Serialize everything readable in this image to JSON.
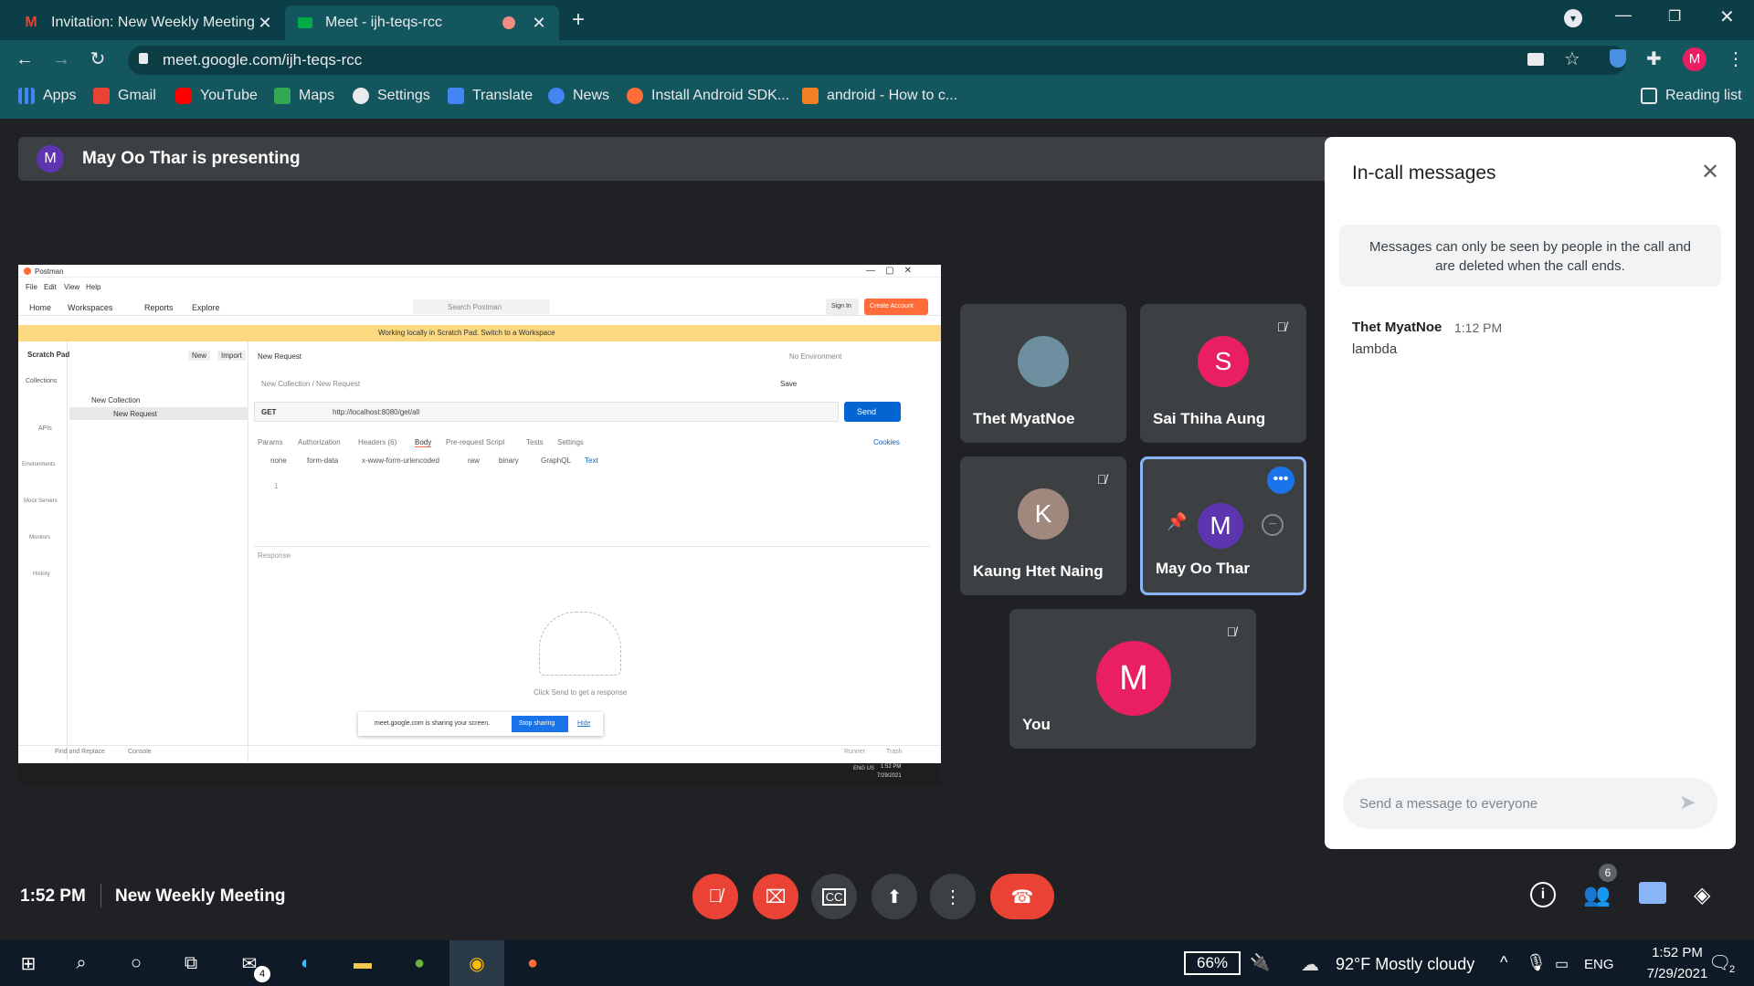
{
  "browser": {
    "tabs": [
      {
        "title": "Invitation: New Weekly Meeting",
        "icon": "gmail-icon"
      },
      {
        "title": "Meet - ijh-teqs-rcc",
        "icon": "meet-icon"
      }
    ],
    "url": "meet.google.com/ijh-teqs-rcc",
    "profile_initial": "M",
    "bookmarks": [
      "Apps",
      "Gmail",
      "YouTube",
      "Maps",
      "Settings",
      "Translate",
      "News",
      "Install Android SDK...",
      "android - How to c..."
    ],
    "reading_list": "Reading list"
  },
  "meet": {
    "presenter_initial": "M",
    "presenting_text": "May Oo Thar is presenting",
    "participants": [
      {
        "name": "Thet MyatNoe",
        "initial": "",
        "color": "#6d8fa0",
        "muted": false
      },
      {
        "name": "Sai Thiha Aung",
        "initial": "S",
        "color": "#e91e63",
        "muted": true
      },
      {
        "name": "Kaung Htet Naing",
        "initial": "K",
        "color": "#a1887f",
        "muted": true
      },
      {
        "name": "May Oo Thar",
        "initial": "M",
        "color": "#5e35b1",
        "muted": false
      },
      {
        "name": "You",
        "initial": "M",
        "color": "#e91e63",
        "muted": true
      }
    ],
    "panel": {
      "title": "In-call messages",
      "notice": "Messages can only be seen by people in the call and are deleted when the call ends.",
      "messages": [
        {
          "sender": "Thet MyatNoe",
          "time": "1:12 PM",
          "text": "lambda"
        }
      ],
      "input_placeholder": "Send a message to everyone"
    },
    "bottom": {
      "time": "1:52 PM",
      "meeting_name": "New Weekly Meeting",
      "people_count": "6"
    }
  },
  "postman": {
    "title": "Postman",
    "menu": [
      "File",
      "Edit",
      "View",
      "Help"
    ],
    "nav": [
      "Home",
      "Workspaces",
      "Reports",
      "Explore"
    ],
    "search": "Search Postman",
    "sign_in": "Sign In",
    "create_account": "Create Account",
    "banner": "Working locally in Scratch Pad. Switch to a Workspace",
    "scratch_pad": "Scratch Pad",
    "new": "New",
    "import": "Import",
    "tab": "New Request",
    "env": "No Environment",
    "breadcrumb": "New Collection / New Request",
    "save": "Save",
    "collection": "New Collection",
    "request": "New Request",
    "method": "GET",
    "request_url": "http://localhost:8080/get/all",
    "send": "Send",
    "req_tabs": [
      "Params",
      "Authorization",
      "Headers (6)",
      "Body",
      "Pre-request Script",
      "Tests",
      "Settings"
    ],
    "cookies": "Cookies",
    "body_types": [
      "none",
      "form-data",
      "x-www-form-urlencoded",
      "raw",
      "binary",
      "GraphQL"
    ],
    "text_type": "Text",
    "line_no": "1",
    "response": "Response",
    "hint": "Click Send to get a response",
    "sharing_msg": "meet.google.com is sharing your screen.",
    "stop_sharing": "Stop sharing",
    "hide": "Hide",
    "sidebar": [
      "Collections",
      "APIs",
      "Environments",
      "Mock Servers",
      "Monitors",
      "History"
    ],
    "footer_left": "Find and Replace",
    "console": "Console",
    "runner": "Runner",
    "trash": "Trash",
    "inner_tray": "ENG US",
    "inner_time": "1:52 PM",
    "inner_date": "7/29/2021"
  },
  "taskbar": {
    "battery": "66%",
    "weather": "92°F  Mostly cloudy",
    "lang": "ENG",
    "time": "1:52 PM",
    "date": "7/29/2021",
    "notif_count": "2",
    "mail_badge": "4"
  }
}
